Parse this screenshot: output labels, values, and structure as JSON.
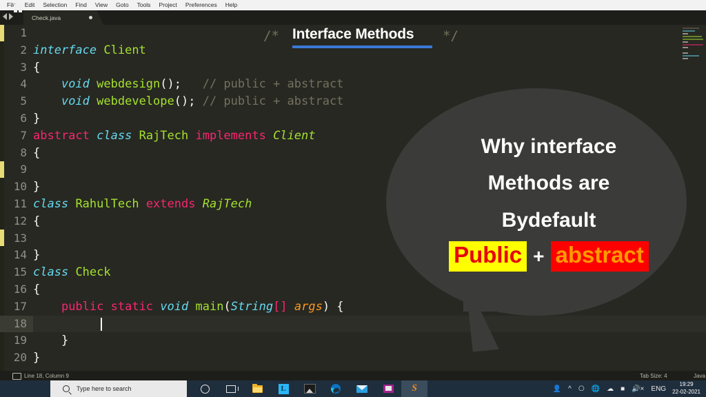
{
  "menubar": {
    "items": [
      "File",
      "Edit",
      "Selection",
      "Find",
      "View",
      "Goto",
      "Tools",
      "Project",
      "Preferences",
      "Help"
    ]
  },
  "tabbar": {
    "prev_icon": "left-arrow-icon",
    "next_icon": "right-arrow-icon",
    "tab_label": "Check.java",
    "modified_indicator": "unsaved-dot"
  },
  "title_overlay": {
    "open_comment": "/*",
    "text": "Interface Methods",
    "close_comment": "*/",
    "underline_color": "#3b78d8"
  },
  "editor": {
    "lines": [
      {
        "n": "1",
        "segments": []
      },
      {
        "n": "2",
        "segments": [
          {
            "t": "interface",
            "c": "kwi"
          },
          {
            "t": " ",
            "c": "pun"
          },
          {
            "t": "Client",
            "c": "typ"
          }
        ]
      },
      {
        "n": "3",
        "segments": [
          {
            "t": "{",
            "c": "pun"
          }
        ]
      },
      {
        "n": "4",
        "segments": [
          {
            "t": "    ",
            "c": "pun"
          },
          {
            "t": "void",
            "c": "kwi"
          },
          {
            "t": " ",
            "c": "pun"
          },
          {
            "t": "webdesign",
            "c": "typ"
          },
          {
            "t": "();",
            "c": "pun"
          },
          {
            "t": "   ",
            "c": "pun"
          },
          {
            "t": "// public + abstract",
            "c": "cmt"
          }
        ]
      },
      {
        "n": "5",
        "segments": [
          {
            "t": "    ",
            "c": "pun"
          },
          {
            "t": "void",
            "c": "kwi"
          },
          {
            "t": " ",
            "c": "pun"
          },
          {
            "t": "webdevelope",
            "c": "typ"
          },
          {
            "t": "();",
            "c": "pun"
          },
          {
            "t": " ",
            "c": "pun"
          },
          {
            "t": "// public + abstract",
            "c": "cmt"
          }
        ]
      },
      {
        "n": "6",
        "segments": [
          {
            "t": "}",
            "c": "pun"
          }
        ]
      },
      {
        "n": "7",
        "segments": [
          {
            "t": "abstract",
            "c": "kw"
          },
          {
            "t": " ",
            "c": "pun"
          },
          {
            "t": "class",
            "c": "kwi"
          },
          {
            "t": " ",
            "c": "pun"
          },
          {
            "t": "RajTech",
            "c": "typ"
          },
          {
            "t": " ",
            "c": "pun"
          },
          {
            "t": "implements",
            "c": "kw"
          },
          {
            "t": " ",
            "c": "pun"
          },
          {
            "t": "Client",
            "c": "typi"
          }
        ]
      },
      {
        "n": "8",
        "segments": [
          {
            "t": "{",
            "c": "pun"
          }
        ]
      },
      {
        "n": "9",
        "segments": []
      },
      {
        "n": "10",
        "segments": [
          {
            "t": "}",
            "c": "pun"
          }
        ]
      },
      {
        "n": "11",
        "segments": [
          {
            "t": "class",
            "c": "kwi"
          },
          {
            "t": " ",
            "c": "pun"
          },
          {
            "t": "RahulTech",
            "c": "typ"
          },
          {
            "t": " ",
            "c": "pun"
          },
          {
            "t": "extends",
            "c": "kw"
          },
          {
            "t": " ",
            "c": "pun"
          },
          {
            "t": "RajTech",
            "c": "typi"
          }
        ]
      },
      {
        "n": "12",
        "segments": [
          {
            "t": "{",
            "c": "pun"
          }
        ]
      },
      {
        "n": "13",
        "segments": []
      },
      {
        "n": "14",
        "segments": [
          {
            "t": "}",
            "c": "pun"
          }
        ]
      },
      {
        "n": "15",
        "segments": [
          {
            "t": "class",
            "c": "kwi"
          },
          {
            "t": " ",
            "c": "pun"
          },
          {
            "t": "Check",
            "c": "typ"
          }
        ]
      },
      {
        "n": "16",
        "segments": [
          {
            "t": "{",
            "c": "pun"
          }
        ]
      },
      {
        "n": "17",
        "segments": [
          {
            "t": "    ",
            "c": "pun"
          },
          {
            "t": "public",
            "c": "kw"
          },
          {
            "t": " ",
            "c": "pun"
          },
          {
            "t": "static",
            "c": "kw"
          },
          {
            "t": " ",
            "c": "pun"
          },
          {
            "t": "void",
            "c": "kwi"
          },
          {
            "t": " ",
            "c": "pun"
          },
          {
            "t": "main",
            "c": "typ"
          },
          {
            "t": "(",
            "c": "par"
          },
          {
            "t": "String",
            "c": "kwi"
          },
          {
            "t": "[]",
            "c": "brk"
          },
          {
            "t": " ",
            "c": "pun"
          },
          {
            "t": "args",
            "c": "arg"
          },
          {
            "t": ") {",
            "c": "par"
          }
        ]
      },
      {
        "n": "18",
        "segments": [],
        "current": true
      },
      {
        "n": "19",
        "segments": [
          {
            "t": "    }",
            "c": "pun"
          }
        ]
      },
      {
        "n": "20",
        "segments": [
          {
            "t": "}",
            "c": "pun"
          }
        ]
      }
    ],
    "gutter_marks": [
      "1",
      "9",
      "13"
    ]
  },
  "bubble": {
    "line1": "Why interface",
    "line2": "Methods are",
    "line3": "Bydefault",
    "highlight_public": "Public",
    "plus": "+",
    "highlight_abstract": "abstract",
    "public_bg": "#ffff00",
    "public_fg": "#e8000d",
    "abstract_bg": "#ff0000",
    "abstract_fg": "#ff9a00"
  },
  "statusbar": {
    "caret": "Line 18, Column 9",
    "tab_size": "Tab Size: 4",
    "language": "Java"
  },
  "taskbar": {
    "search_placeholder": "Type here to search",
    "lang": "ENG",
    "time": "19:29",
    "date": "22-02-2021",
    "icons": [
      "windows-start-icon",
      "search-icon",
      "cortana-icon",
      "task-view-icon",
      "file-explorer-icon",
      "app-l-icon",
      "photos-icon",
      "edge-icon",
      "mail-icon",
      "remote-desktop-icon",
      "sublime-text-icon"
    ],
    "tray_icons": [
      "people-icon",
      "chevron-up-icon",
      "monitor-icon",
      "network-globe-icon",
      "onedrive-cloud-icon",
      "battery-icon",
      "speaker-muted-icon"
    ]
  }
}
